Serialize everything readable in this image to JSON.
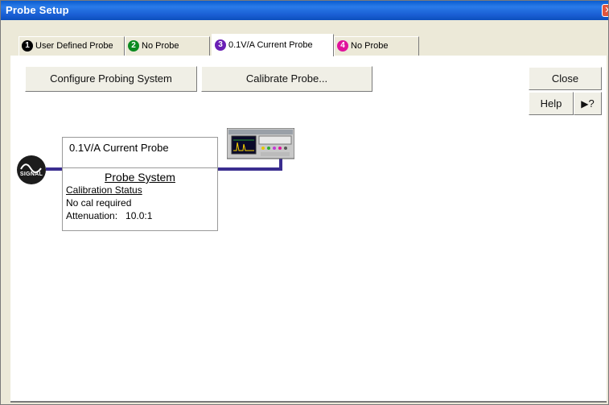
{
  "window": {
    "title": "Probe Setup"
  },
  "tabs": [
    {
      "num": "1",
      "label": "User Defined Probe",
      "color": "#000000"
    },
    {
      "num": "2",
      "label": "No Probe",
      "color": "#0b8a1f"
    },
    {
      "num": "3",
      "label": "0.1V/A Current Probe",
      "color": "#6a1fb5"
    },
    {
      "num": "4",
      "label": "No Probe",
      "color": "#e0139c"
    }
  ],
  "buttons": {
    "configure": "Configure Probing System",
    "calibrate": "Calibrate Probe...",
    "close": "Close",
    "help": "Help",
    "whats_this": "?"
  },
  "probe": {
    "name": "0.1V/A Current Probe",
    "system_title": "Probe System",
    "calibration_status_label": "Calibration Status",
    "calibration_status_value": "No cal required",
    "attenuation": "Attenuation:   10.0:1"
  },
  "signal": {
    "label": "SIGNAL"
  },
  "colors": {
    "titlebar": "#0a5ccf",
    "connector": "#3a2d8f",
    "panel": "#ffffff",
    "window_bg": "#ece9d8"
  }
}
